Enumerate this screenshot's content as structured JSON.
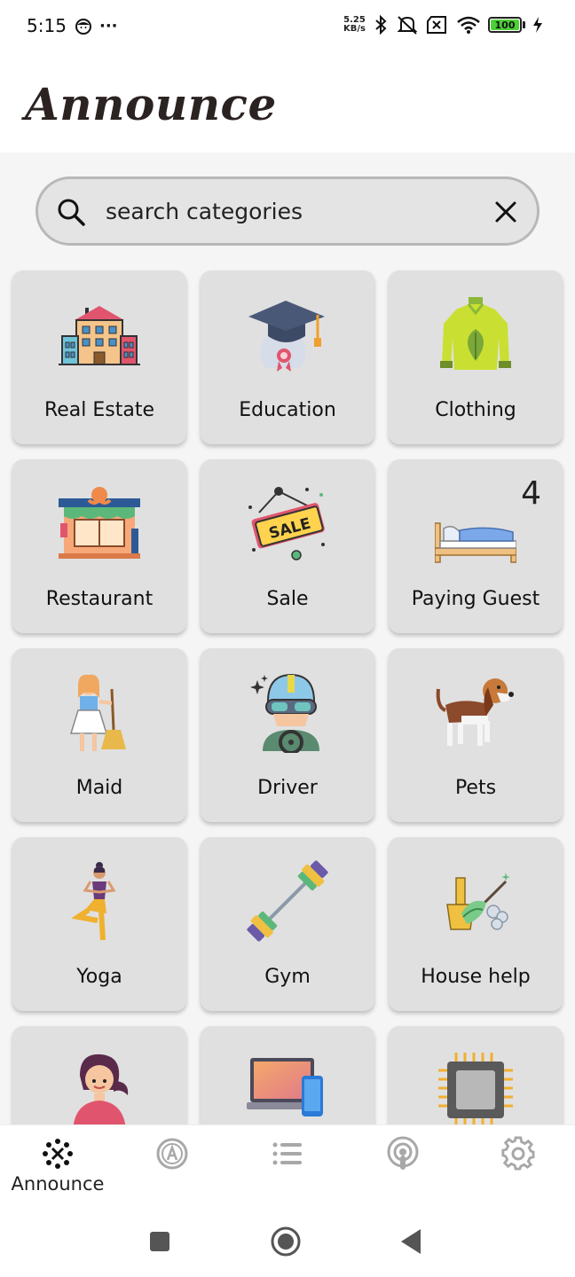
{
  "status_bar": {
    "time": "5:15",
    "more": "···",
    "net_speed_value": "5.25",
    "net_speed_unit": "KB/s",
    "battery": "100",
    "icons": [
      "face-icon",
      "bluetooth-icon",
      "mute-icon",
      "no-sim-icon",
      "wifi-icon",
      "battery-icon",
      "charging-icon"
    ]
  },
  "header": {
    "title": "Announce"
  },
  "search": {
    "value": "search categories",
    "placeholder": "search categories"
  },
  "categories": [
    {
      "label": "Real Estate",
      "icon": "building-icon"
    },
    {
      "label": "Education",
      "icon": "graduation-cap-icon"
    },
    {
      "label": "Clothing",
      "icon": "jacket-icon"
    },
    {
      "label": "Restaurant",
      "icon": "restaurant-icon"
    },
    {
      "label": "Sale",
      "icon": "sale-sign-icon"
    },
    {
      "label": "Paying Guest",
      "icon": "bed-icon",
      "badge": "4"
    },
    {
      "label": "Maid",
      "icon": "maid-icon"
    },
    {
      "label": "Driver",
      "icon": "driver-icon"
    },
    {
      "label": "Pets",
      "icon": "dog-icon"
    },
    {
      "label": "Yoga",
      "icon": "yoga-icon"
    },
    {
      "label": "Gym",
      "icon": "dumbbell-icon"
    },
    {
      "label": "House help",
      "icon": "cleaning-icon"
    },
    {
      "label": "",
      "icon": "woman-icon"
    },
    {
      "label": "",
      "icon": "laptop-phone-icon"
    },
    {
      "label": "",
      "icon": "chip-icon"
    }
  ],
  "bottom_nav": {
    "items": [
      {
        "label": "Announce",
        "icon": "announce-icon",
        "active": true
      },
      {
        "label": "",
        "icon": "a-circle-icon"
      },
      {
        "label": "",
        "icon": "list-icon"
      },
      {
        "label": "",
        "icon": "podcast-icon"
      },
      {
        "label": "",
        "icon": "gear-icon"
      }
    ]
  },
  "colors": {
    "card_bg": "#e0e0e0",
    "main_bg": "#f5f5f5",
    "title": "#2b2222",
    "inactive_icon": "#a8a8a8"
  }
}
